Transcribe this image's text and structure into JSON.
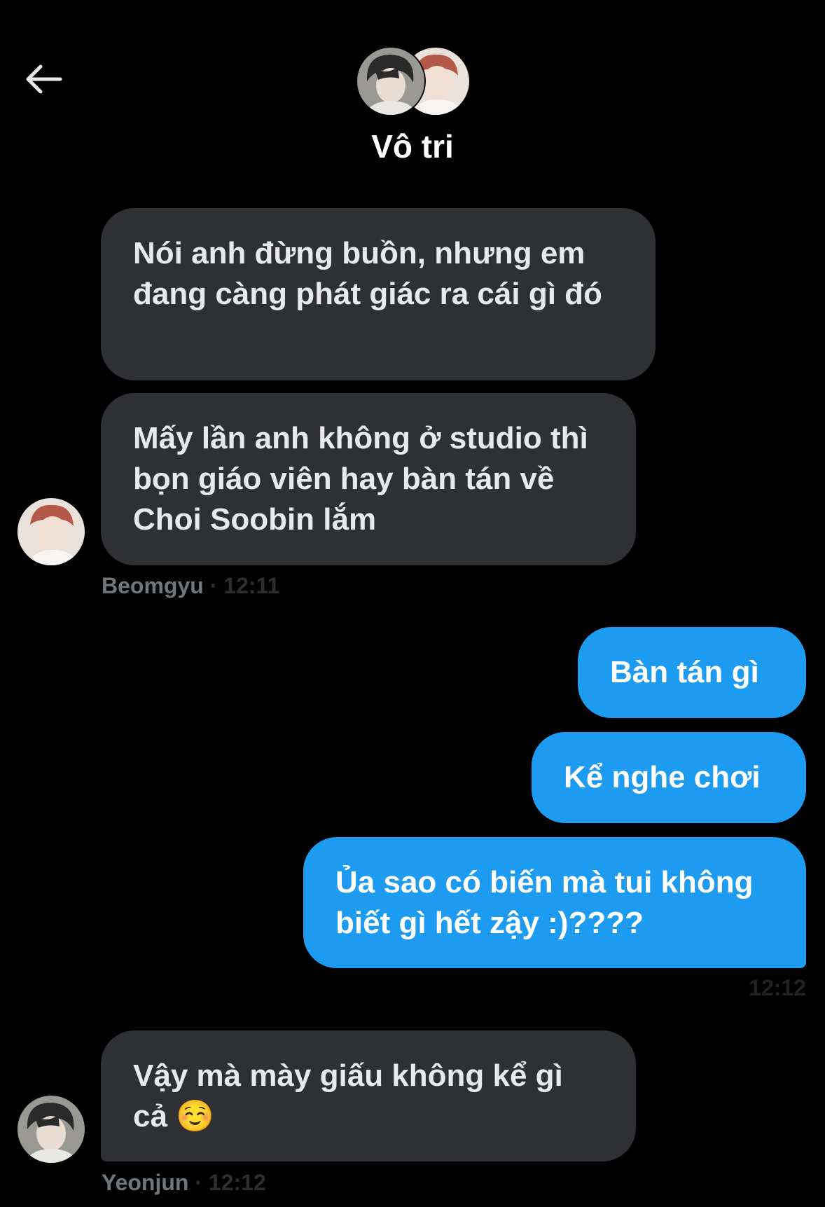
{
  "header": {
    "title": "Vô tri",
    "back_icon": "arrow-left-icon"
  },
  "messages": [
    {
      "type": "received",
      "text": "Nói anh đừng buồn, nhưng em đang càng phát giác ra cái gì đó"
    },
    {
      "type": "received",
      "text": "Mấy lần anh không ở studio thì bọn giáo viên hay bàn tán về Choi Soobin lắm"
    },
    {
      "type": "sent",
      "text": "Bàn tán gì"
    },
    {
      "type": "sent",
      "text": "Kể nghe chơi"
    },
    {
      "type": "sent",
      "text": "Ủa sao có biến mà tui không biết gì hết zậy :)????"
    },
    {
      "type": "received",
      "text": "Vậy mà mày giấu không kể gì cả ☺️"
    }
  ],
  "meta": {
    "beomgyu": {
      "sender": "Beomgyu",
      "time": " · 12:11"
    },
    "sent_time": "12:12",
    "yeonjun": {
      "sender": "Yeonjun",
      "time": " · 12:12"
    }
  },
  "colors": {
    "background": "#000000",
    "received_bubble": "#2f3033",
    "sent_bubble": "#1d9bf0",
    "meta_text": "#71767b"
  }
}
